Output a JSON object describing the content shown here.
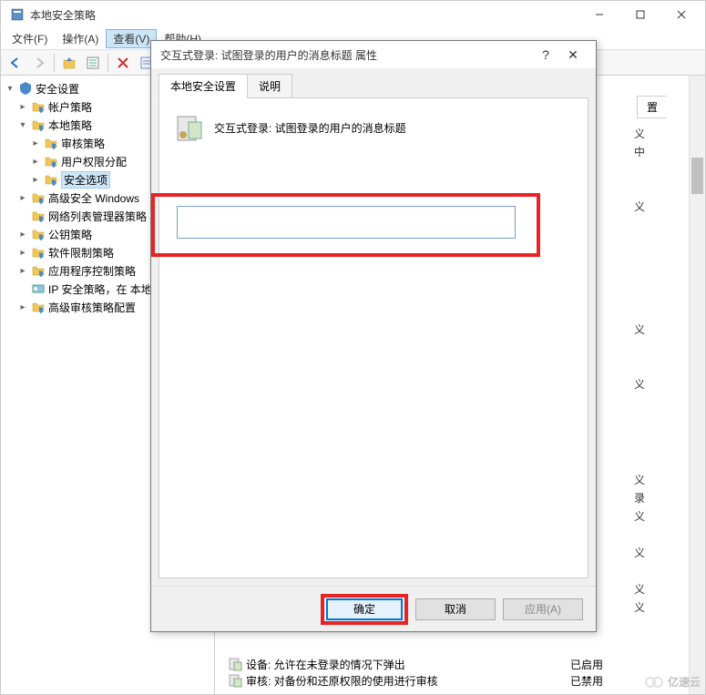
{
  "window": {
    "title": "本地安全策略"
  },
  "menu": {
    "file": "文件(F)",
    "action": "操作(A)",
    "view": "查看(V)",
    "help": "帮助(H)"
  },
  "tree": {
    "root": "安全设置",
    "items": [
      {
        "label": "帐户策略",
        "expanded": false,
        "indent": 1
      },
      {
        "label": "本地策略",
        "expanded": true,
        "indent": 1
      },
      {
        "label": "审核策略",
        "expanded": false,
        "indent": 2
      },
      {
        "label": "用户权限分配",
        "expanded": false,
        "indent": 2
      },
      {
        "label": "安全选项",
        "expanded": false,
        "indent": 2,
        "selected": true
      },
      {
        "label": "高级安全 Windows",
        "expanded": false,
        "indent": 1
      },
      {
        "label": "网络列表管理器策略",
        "indent": 1,
        "leaf": true
      },
      {
        "label": "公钥策略",
        "expanded": false,
        "indent": 1
      },
      {
        "label": "软件限制策略",
        "expanded": false,
        "indent": 1
      },
      {
        "label": "应用程序控制策略",
        "expanded": false,
        "indent": 1
      },
      {
        "label": "IP 安全策略，在 本地",
        "indent": 1,
        "ext": true
      },
      {
        "label": "高级审核策略配置",
        "expanded": false,
        "indent": 1
      }
    ]
  },
  "dialog": {
    "title": "交互式登录: 试图登录的用户的消息标题 属性",
    "tabs": {
      "local": "本地安全设置",
      "explain": "说明"
    },
    "policy_name": "交互式登录: 试图登录的用户的消息标题",
    "input_value": "",
    "buttons": {
      "ok": "确定",
      "cancel": "取消",
      "apply": "应用(A)"
    }
  },
  "list_fragments": {
    "header_col2": "置",
    "rows": [
      {
        "v": "义"
      },
      {
        "v": "中"
      },
      {
        "v": "义"
      },
      {
        "v": "义"
      },
      {
        "v": ""
      },
      {
        "v": "义"
      },
      {
        "v": "义"
      },
      {
        "v": "录"
      },
      {
        "v": "义"
      },
      {
        "v": "义"
      },
      {
        "v": "义"
      },
      {
        "v": "义"
      }
    ],
    "bottom_rows": [
      {
        "name": "设备: 允许在未登录的情况下弹出",
        "status": "已启用"
      },
      {
        "name": "审核: 对备份和还原权限的使用进行审核",
        "status": "已禁用"
      }
    ]
  },
  "watermark": "亿速云"
}
